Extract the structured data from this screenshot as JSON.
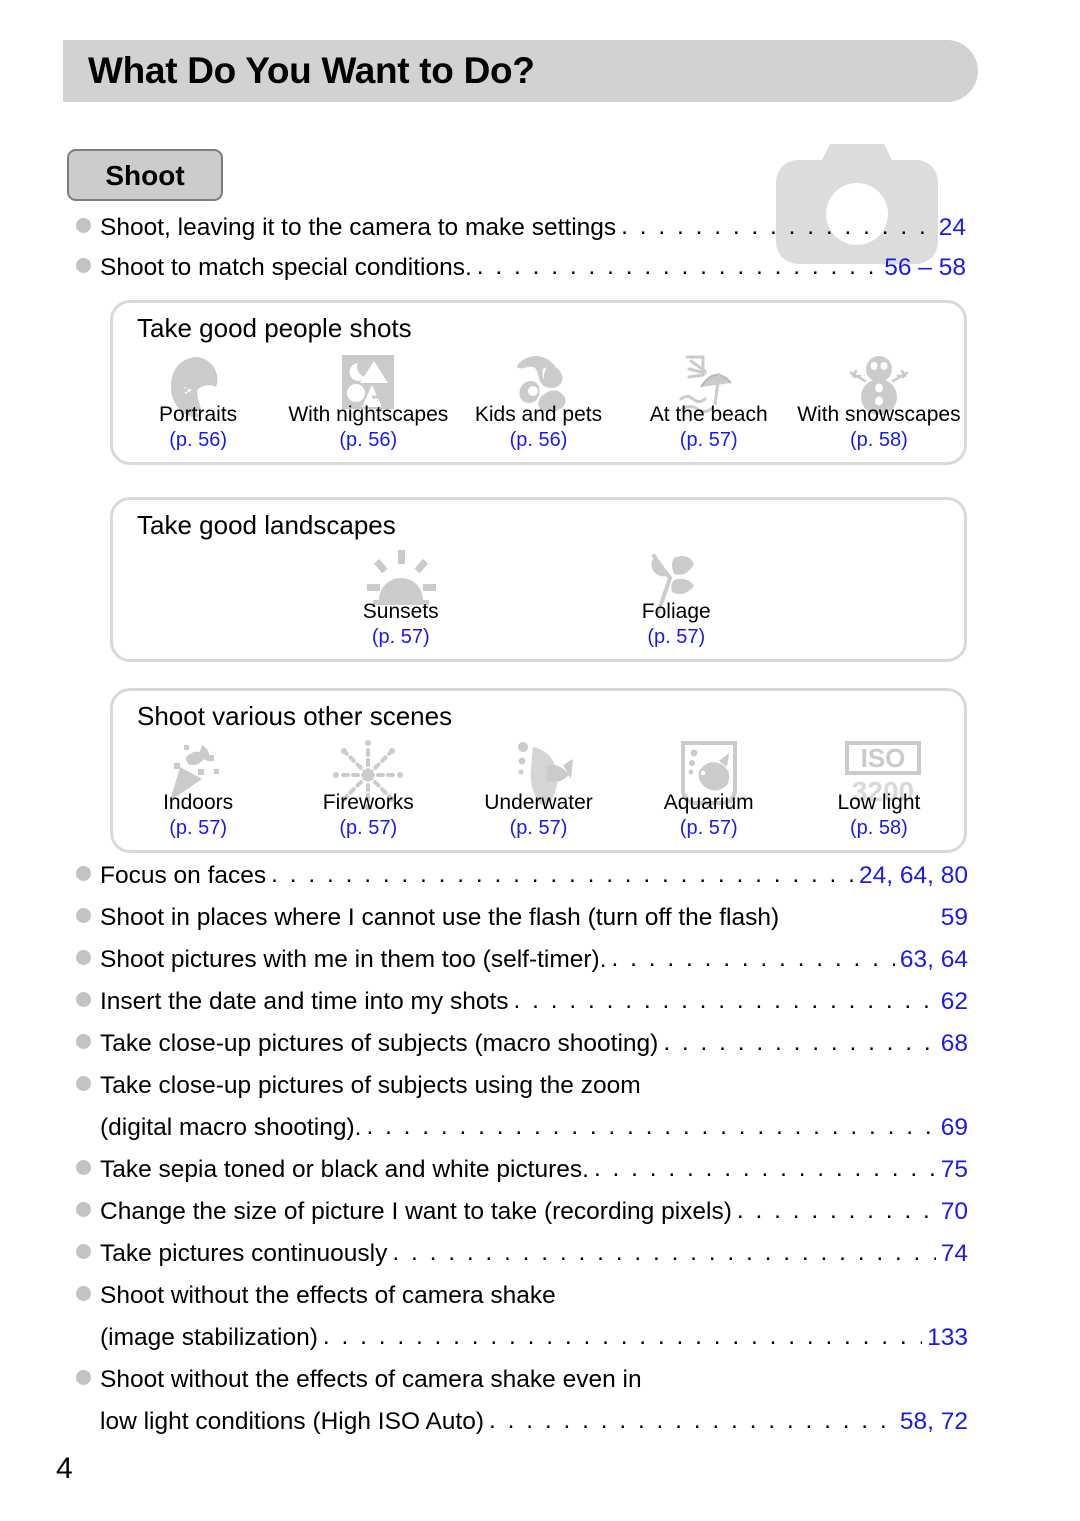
{
  "header": {
    "title": "What Do You Want to Do?"
  },
  "section": {
    "badge_label": "Shoot",
    "watermark_icon": "camera-icon"
  },
  "colors": {
    "page_link": "#1a1aee",
    "header_bar": "#d2d2d2",
    "badge_fill": "#cccccc",
    "badge_border": "#7d7d7d",
    "box_border": "#d9d9d9",
    "icon_gray": "#cccccc",
    "bullet_gray": "#c3c3c3"
  },
  "top_entries": [
    {
      "label": "Shoot, leaving it to the camera to make settings",
      "pages": "24"
    },
    {
      "label": "Shoot to match special conditions.",
      "pages": "56 – 58"
    }
  ],
  "groups": [
    {
      "title": "Take good people shots",
      "items": [
        {
          "icon": "portrait-face-icon",
          "label": "Portraits",
          "page": "(p. 56)"
        },
        {
          "icon": "night-scene-icon",
          "label": "With nightscapes",
          "page": "(p. 56)"
        },
        {
          "icon": "kids-and-pets-icon",
          "label": "Kids and pets",
          "page": "(p. 56)"
        },
        {
          "icon": "beach-umbrella-icon",
          "label": "At the beach",
          "page": "(p. 57)"
        },
        {
          "icon": "snowman-icon",
          "label": "With snowscapes",
          "page": "(p. 58)"
        }
      ]
    },
    {
      "title": "Take good landscapes",
      "items": [
        {
          "icon": "sunset-icon",
          "label": "Sunsets",
          "page": "(p. 57)"
        },
        {
          "icon": "foliage-icon",
          "label": "Foliage",
          "page": "(p. 57)"
        }
      ]
    },
    {
      "title": "Shoot various other scenes",
      "items": [
        {
          "icon": "indoors-icon",
          "label": "Indoors",
          "page": "(p. 57)"
        },
        {
          "icon": "fireworks-icon",
          "label": "Fireworks",
          "page": "(p. 57)"
        },
        {
          "icon": "underwater-icon",
          "label": "Underwater",
          "page": "(p. 57)"
        },
        {
          "icon": "aquarium-icon",
          "label": "Aquarium",
          "page": "(p. 57)"
        },
        {
          "icon": "iso-3200-icon",
          "label": "Low light",
          "page": "(p. 58)"
        }
      ]
    }
  ],
  "list_entries": [
    {
      "label": "Focus on faces",
      "pages": "24, 64, 80",
      "leader": true,
      "continuation": false
    },
    {
      "label": "Shoot in places where I cannot use the flash (turn off the flash)",
      "pages": "59",
      "leader": false,
      "continuation": false
    },
    {
      "label": "Shoot pictures with me in them too (self-timer).",
      "pages": "63, 64",
      "leader": true,
      "continuation": false
    },
    {
      "label": "Insert the date and time into my shots",
      "pages": "62",
      "leader": true,
      "continuation": false
    },
    {
      "label": "Take close-up pictures of subjects (macro shooting)",
      "pages": "68",
      "leader": true,
      "continuation": false
    },
    {
      "label": "Take close-up pictures of subjects using the zoom",
      "pages": "",
      "leader": false,
      "continuation": false
    },
    {
      "label": "(digital macro shooting).",
      "pages": "69",
      "leader": true,
      "continuation": true
    },
    {
      "label": "Take sepia toned or black and white pictures.",
      "pages": "75",
      "leader": true,
      "continuation": false
    },
    {
      "label": "Change the size of picture I want to take (recording pixels)",
      "pages": "70",
      "leader": true,
      "continuation": false
    },
    {
      "label": "Take pictures continuously",
      "pages": "74",
      "leader": true,
      "continuation": false
    },
    {
      "label": "Shoot without the effects of camera shake",
      "pages": "",
      "leader": false,
      "continuation": false
    },
    {
      "label": "(image stabilization)",
      "pages": "133",
      "leader": true,
      "continuation": true
    },
    {
      "label": "Shoot without the effects of camera shake even in",
      "pages": "",
      "leader": false,
      "continuation": false
    },
    {
      "label": "low light conditions (High ISO Auto)",
      "pages": "58, 72",
      "leader": true,
      "continuation": true
    }
  ],
  "footer": {
    "page_number": "4"
  }
}
